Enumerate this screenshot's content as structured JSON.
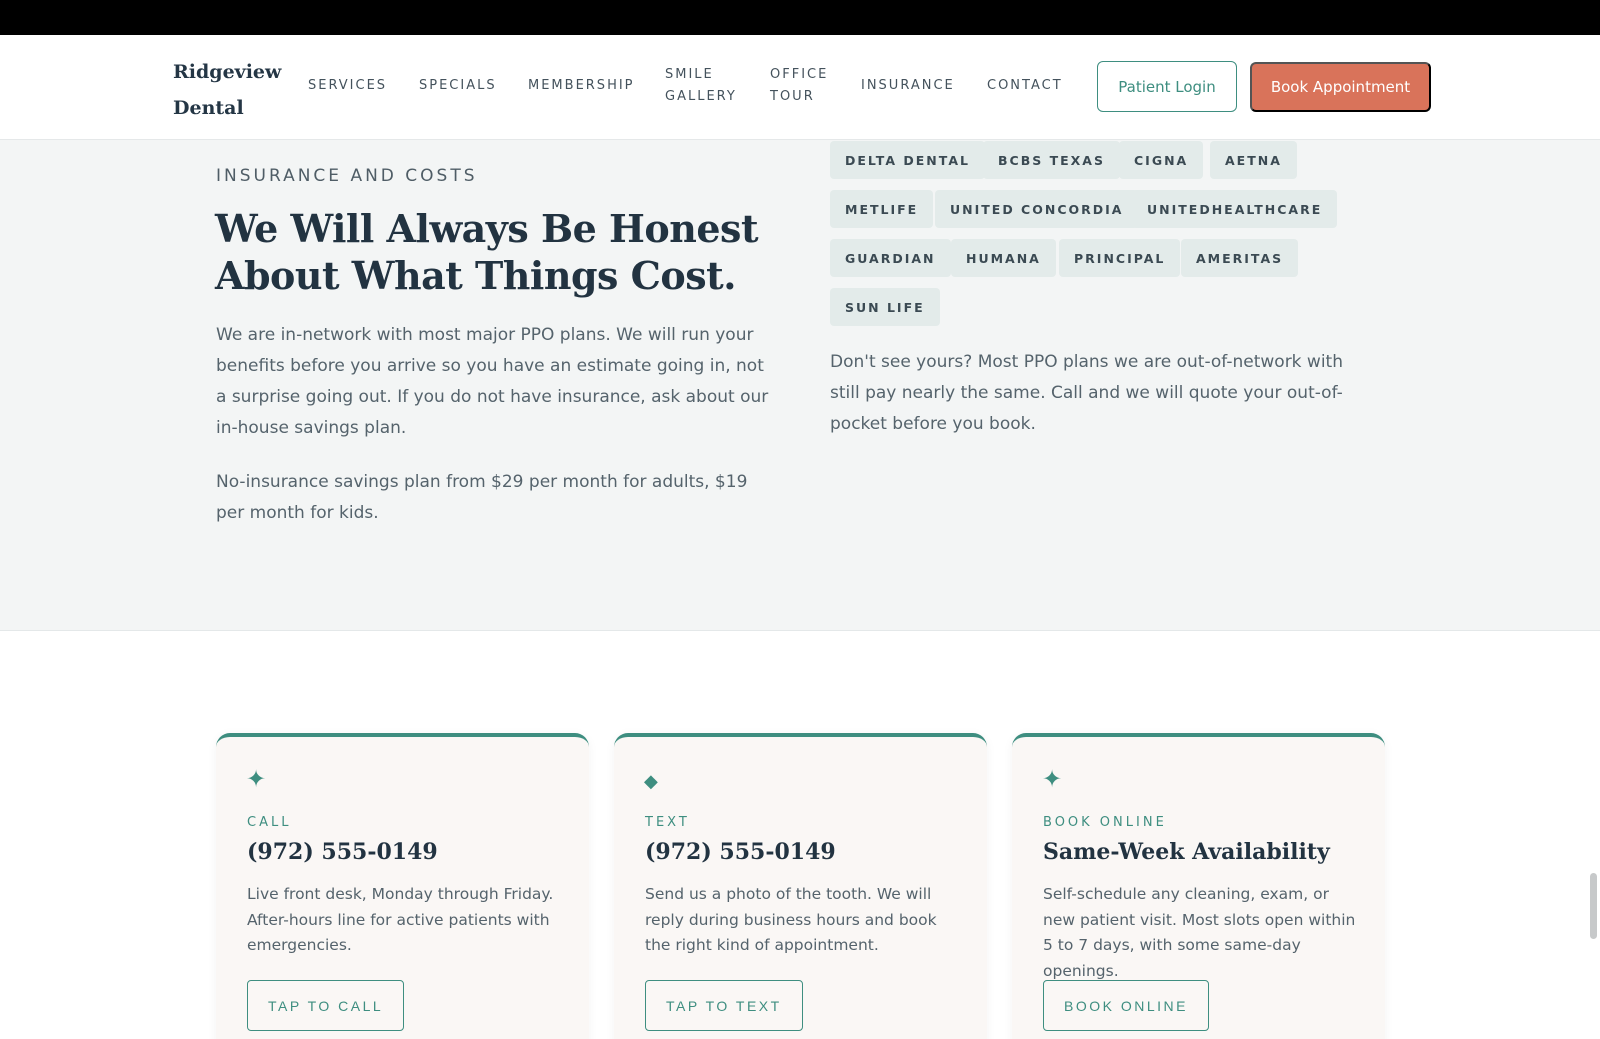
{
  "header": {
    "logo": "Ridgeview Dental",
    "nav": [
      "SERVICES",
      "SPECIALS",
      "MEMBERSHIP",
      "SMILE GALLERY",
      "OFFICE TOUR",
      "INSURANCE",
      "CONTACT"
    ],
    "login_label": "Patient Login",
    "book_label": "Book Appointment"
  },
  "insurance": {
    "eyebrow": "INSURANCE AND COSTS",
    "headline": "We Will Always Be Honest About What Things Cost.",
    "paragraph1": "We are in-network with most major PPO plans. We will run your benefits before you arrive so you have an estimate going in, not a surprise going out. If you do not have insurance, ask about our in-house savings plan.",
    "paragraph2": "No-insurance savings plan from $29 per month for adults, $19 per month for kids.",
    "carriers": [
      "DELTA DENTAL",
      "BCBS TEXAS",
      "CIGNA",
      "AETNA",
      "METLIFE",
      "UNITED CONCORDIA",
      "UNITEDHEALTHCARE",
      "GUARDIAN",
      "HUMANA",
      "PRINCIPAL",
      "AMERITAS",
      "SUN LIFE"
    ],
    "note": "Don't see yours? Most PPO plans we are out-of-network with still pay nearly the same. Call and we will quote your out-of-pocket before you book."
  },
  "contact_cards": [
    {
      "icon": "sparkle-icon",
      "label": "CALL",
      "title": "(972) 555-0149",
      "desc": "Live front desk, Monday through Friday. After-hours line for active patients with emergencies.",
      "cta": "TAP TO CALL"
    },
    {
      "icon": "diamond-icon",
      "label": "TEXT",
      "title": "(972) 555-0149",
      "desc": "Send us a photo of the tooth. We will reply during business hours and book the right kind of appointment.",
      "cta": "TAP TO TEXT"
    },
    {
      "icon": "sparkle-icon",
      "label": "BOOK ONLINE",
      "title": "Same-Week Availability",
      "desc": "Self-schedule any cleaning, exam, or new patient visit. Most slots open within 5 to 7 days, with some same-day openings.",
      "cta": "BOOK ONLINE"
    }
  ],
  "colors": {
    "accent": "#3e8e80",
    "cta": "#d9735a",
    "heading": "#223341"
  }
}
